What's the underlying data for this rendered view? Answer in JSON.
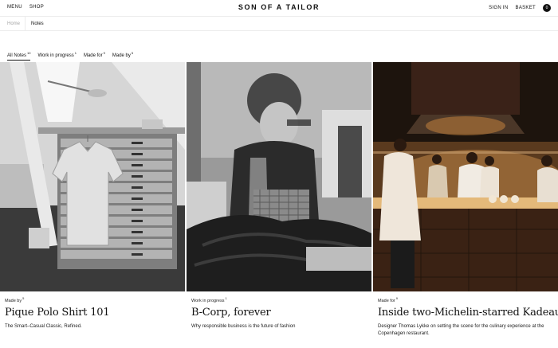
{
  "header": {
    "menu_label": "MENU",
    "shop_label": "SHOP",
    "brand": "SON OF A TAILOR",
    "sign_in_label": "SIGN IN",
    "basket_label": "BASKET",
    "basket_count": "0"
  },
  "breadcrumb": {
    "home": "Home",
    "current": "Notes"
  },
  "filters": [
    {
      "label": "All Notes",
      "count": "10"
    },
    {
      "label": "Work in progress",
      "count": "1"
    },
    {
      "label": "Made for",
      "count": "9"
    },
    {
      "label": "Made by",
      "count": "5"
    }
  ],
  "cards": [
    {
      "tag": "Made by",
      "tag_count": "5",
      "title": "Pique Polo Shirt 101",
      "description": "The Smart–Casual Classic, Refined."
    },
    {
      "tag": "Work in progress",
      "tag_count": "1",
      "title": "B-Corp, forever",
      "description": "Why responsible business is the future of fashion"
    },
    {
      "tag": "Made for",
      "tag_count": "9",
      "title": "Inside two-Michelin-starred Kadeau",
      "description": "Designer Thomas Lykke on setting the scene for the culinary experience at the Copenhagen restaurant."
    }
  ],
  "colors": {
    "text": "#111111",
    "muted": "#a5a5a5",
    "divider": "#ececec"
  }
}
